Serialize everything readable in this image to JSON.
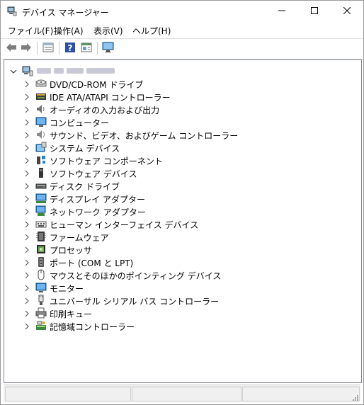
{
  "window": {
    "title": "デバイス マネージャー",
    "controls": {
      "minimize": "minimize",
      "maximize": "maximize",
      "close": "close"
    }
  },
  "menu": [
    {
      "label": "ファイル(F)"
    },
    {
      "label": "操作(A)"
    },
    {
      "label": "表示(V)"
    },
    {
      "label": "ヘルプ(H)"
    }
  ],
  "toolbar": {
    "buttons": [
      "back-arrow-icon",
      "forward-arrow-icon",
      "properties-icon",
      "help-icon",
      "action-pane-icon",
      "monitor-icon"
    ]
  },
  "tree": {
    "root": {
      "icon": "computer-icon",
      "name_redacted": true
    },
    "items": [
      {
        "label": "DVD/CD-ROM ドライブ",
        "icon": "optical-drive-icon"
      },
      {
        "label": "IDE ATA/ATAPI コントローラー",
        "icon": "ide-controller-icon"
      },
      {
        "label": "オーディオの入力および出力",
        "icon": "speaker-icon"
      },
      {
        "label": "コンピューター",
        "icon": "computer-monitor-icon"
      },
      {
        "label": "サウンド、ビデオ、およびゲーム コントローラー",
        "icon": "sound-icon"
      },
      {
        "label": "システム デバイス",
        "icon": "system-device-icon"
      },
      {
        "label": "ソフトウェア コンポーネント",
        "icon": "software-component-icon"
      },
      {
        "label": "ソフトウェア デバイス",
        "icon": "software-device-icon"
      },
      {
        "label": "ディスク ドライブ",
        "icon": "disk-drive-icon"
      },
      {
        "label": "ディスプレイ アダプター",
        "icon": "display-adapter-icon"
      },
      {
        "label": "ネットワーク アダプター",
        "icon": "network-adapter-icon"
      },
      {
        "label": "ヒューマン インターフェイス デバイス",
        "icon": "hid-icon"
      },
      {
        "label": "ファームウェア",
        "icon": "firmware-icon"
      },
      {
        "label": "プロセッサ",
        "icon": "processor-icon"
      },
      {
        "label": "ポート (COM と LPT)",
        "icon": "port-icon"
      },
      {
        "label": "マウスとそのほかのポインティング デバイス",
        "icon": "mouse-icon"
      },
      {
        "label": "モニター",
        "icon": "monitor-icon"
      },
      {
        "label": "ユニバーサル シリアル バス コントローラー",
        "icon": "usb-icon"
      },
      {
        "label": "印刷キュー",
        "icon": "printer-icon"
      },
      {
        "label": "記憶域コントローラー",
        "icon": "storage-controller-icon"
      }
    ]
  }
}
